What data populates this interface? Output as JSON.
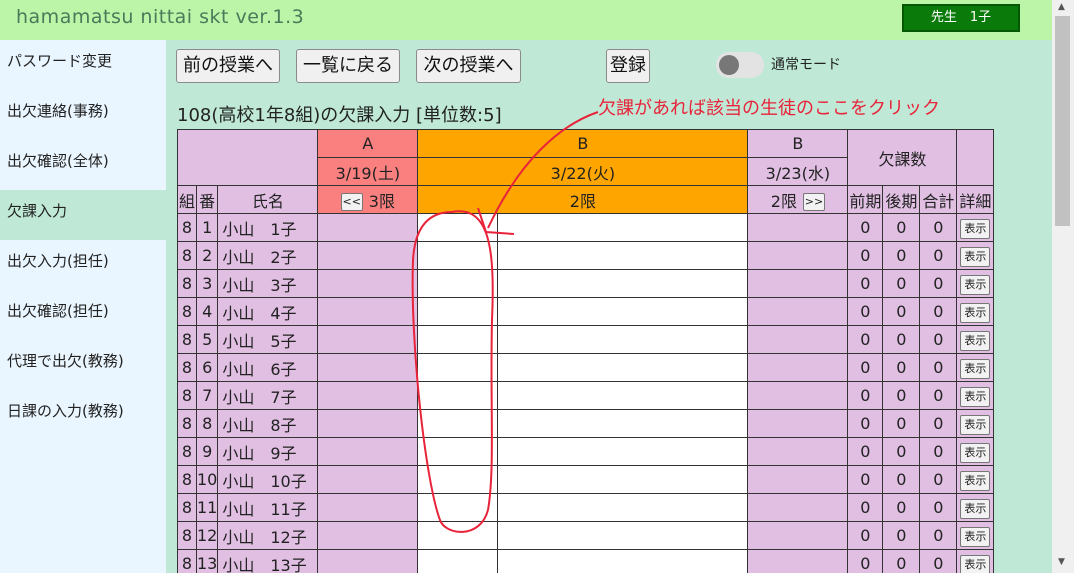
{
  "header": {
    "app_title": "hamamatsu nittai skt ver.1.3",
    "user_badge": "先生　1子"
  },
  "sidebar": {
    "items": [
      {
        "label": "パスワード変更"
      },
      {
        "label": "出欠連絡(事務)"
      },
      {
        "label": "出欠確認(全体)"
      },
      {
        "label": "欠課入力",
        "active": true
      },
      {
        "label": "出欠入力(担任)"
      },
      {
        "label": "出欠確認(担任)"
      },
      {
        "label": "代理で出欠(教務)"
      },
      {
        "label": "日課の入力(教務)"
      }
    ]
  },
  "toolbar": {
    "prev_label": "前の授業へ",
    "list_label": "一覧に戻る",
    "next_label": "次の授業へ",
    "register_label": "登録",
    "mode_label": "通常モード",
    "mode_on": false
  },
  "section_title": "108(高校1年8組)の欠課入力 [単位数:5]",
  "annotation": "欠課があれば該当の生徒のここをクリック",
  "table": {
    "periods": [
      {
        "group": "A",
        "date": "3/19(土)",
        "period": "3限",
        "nav": "<<"
      },
      {
        "group": "B",
        "date": "3/22(火)",
        "period": "2限"
      },
      {
        "group": "B",
        "date": "3/23(水)",
        "period": "2限",
        "nav": ">>"
      }
    ],
    "absence_header": "欠課数",
    "col_headers": {
      "class": "組",
      "number": "番",
      "name": "氏名",
      "first_term": "前期",
      "second_term": "後期",
      "total": "合計",
      "detail": "詳細"
    },
    "detail_button": "表示",
    "rows": [
      {
        "class": "8",
        "number": "1",
        "name": "小山　1子",
        "first": "0",
        "second": "0",
        "total": "0"
      },
      {
        "class": "8",
        "number": "2",
        "name": "小山　2子",
        "first": "0",
        "second": "0",
        "total": "0"
      },
      {
        "class": "8",
        "number": "3",
        "name": "小山　3子",
        "first": "0",
        "second": "0",
        "total": "0"
      },
      {
        "class": "8",
        "number": "4",
        "name": "小山　4子",
        "first": "0",
        "second": "0",
        "total": "0"
      },
      {
        "class": "8",
        "number": "5",
        "name": "小山　5子",
        "first": "0",
        "second": "0",
        "total": "0"
      },
      {
        "class": "8",
        "number": "6",
        "name": "小山　6子",
        "first": "0",
        "second": "0",
        "total": "0"
      },
      {
        "class": "8",
        "number": "7",
        "name": "小山　7子",
        "first": "0",
        "second": "0",
        "total": "0"
      },
      {
        "class": "8",
        "number": "8",
        "name": "小山　8子",
        "first": "0",
        "second": "0",
        "total": "0"
      },
      {
        "class": "8",
        "number": "9",
        "name": "小山　9子",
        "first": "0",
        "second": "0",
        "total": "0"
      },
      {
        "class": "8",
        "number": "10",
        "name": "小山　10子",
        "first": "0",
        "second": "0",
        "total": "0"
      },
      {
        "class": "8",
        "number": "11",
        "name": "小山　11子",
        "first": "0",
        "second": "0",
        "total": "0"
      },
      {
        "class": "8",
        "number": "12",
        "name": "小山　12子",
        "first": "0",
        "second": "0",
        "total": "0"
      },
      {
        "class": "8",
        "number": "13",
        "name": "小山　13子",
        "first": "0",
        "second": "0",
        "total": "0"
      }
    ]
  },
  "colors": {
    "header_bg": "#bdf5a8",
    "main_bg": "#bfe9d6",
    "sidebar_bg": "#eaf6ff",
    "cell_pink": "#e0bfe3",
    "cell_salmon": "#fa8080",
    "cell_orange": "#ffa500",
    "annotation_red": "#e8233a",
    "badge_green": "#0a7a0a"
  }
}
